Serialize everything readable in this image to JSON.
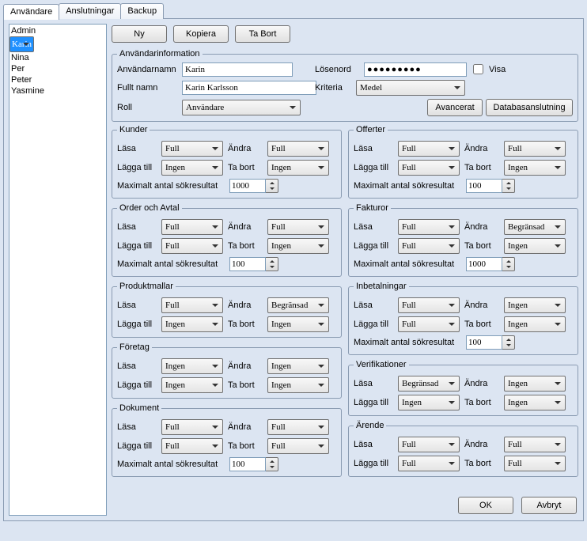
{
  "tabs": {
    "users": "Användare",
    "connections": "Anslutningar",
    "backup": "Backup"
  },
  "userlist": [
    "Admin",
    "Karin",
    "Nina",
    "Per",
    "Peter",
    "Yasmine"
  ],
  "selected_user_index": 1,
  "buttons": {
    "new": "Ny",
    "copy": "Kopiera",
    "delete": "Ta Bort",
    "advanced": "Avancerat",
    "dbconn": "Databasanslutning",
    "ok": "OK",
    "cancel": "Avbryt"
  },
  "info": {
    "legend": "Användarinformation",
    "username_label": "Användarnamn",
    "username": "Karin",
    "fullname_label": "Fullt namn",
    "fullname": "Karin Karlsson",
    "role_label": "Roll",
    "role": "Användare",
    "password_label": "Lösenord",
    "password": "●●●●●●●●●",
    "show_label": "Visa",
    "criteria_label": "Kriteria",
    "criteria": "Medel"
  },
  "perm_labels": {
    "read": "Läsa",
    "change": "Ändra",
    "add": "Lägga till",
    "delete": "Ta bort",
    "max": "Maximalt antal sökresultat"
  },
  "groups": {
    "kunder": {
      "legend": "Kunder",
      "read": "Full",
      "change": "Full",
      "add": "Ingen",
      "delete": "Ingen",
      "max": "1000"
    },
    "offerter": {
      "legend": "Offerter",
      "read": "Full",
      "change": "Full",
      "add": "Full",
      "delete": "Ingen",
      "max": "100"
    },
    "orderavtal": {
      "legend": "Order och Avtal",
      "read": "Full",
      "change": "Full",
      "add": "Full",
      "delete": "Ingen",
      "max": "100"
    },
    "fakturor": {
      "legend": "Fakturor",
      "read": "Full",
      "change": "Begränsad",
      "add": "Full",
      "delete": "Ingen",
      "max": "1000"
    },
    "produktmallar": {
      "legend": "Produktmallar",
      "read": "Full",
      "change": "Begränsad",
      "add": "Ingen",
      "delete": "Ingen"
    },
    "inbetalningar": {
      "legend": "Inbetalningar",
      "read": "Full",
      "change": "Ingen",
      "add": "Full",
      "delete": "Ingen",
      "max": "100"
    },
    "foretag": {
      "legend": "Företag",
      "read": "Ingen",
      "change": "Ingen",
      "add": "Ingen",
      "delete": "Ingen"
    },
    "verifikationer": {
      "legend": "Verifikationer",
      "read": "Begränsad",
      "change": "Ingen",
      "add": "Ingen",
      "delete": "Ingen"
    },
    "dokument": {
      "legend": "Dokument",
      "read": "Full",
      "change": "Full",
      "add": "Full",
      "delete": "Full",
      "max": "100"
    },
    "arende": {
      "legend": "Ärende",
      "read": "Full",
      "change": "Full",
      "add": "Full",
      "delete": "Full"
    }
  }
}
